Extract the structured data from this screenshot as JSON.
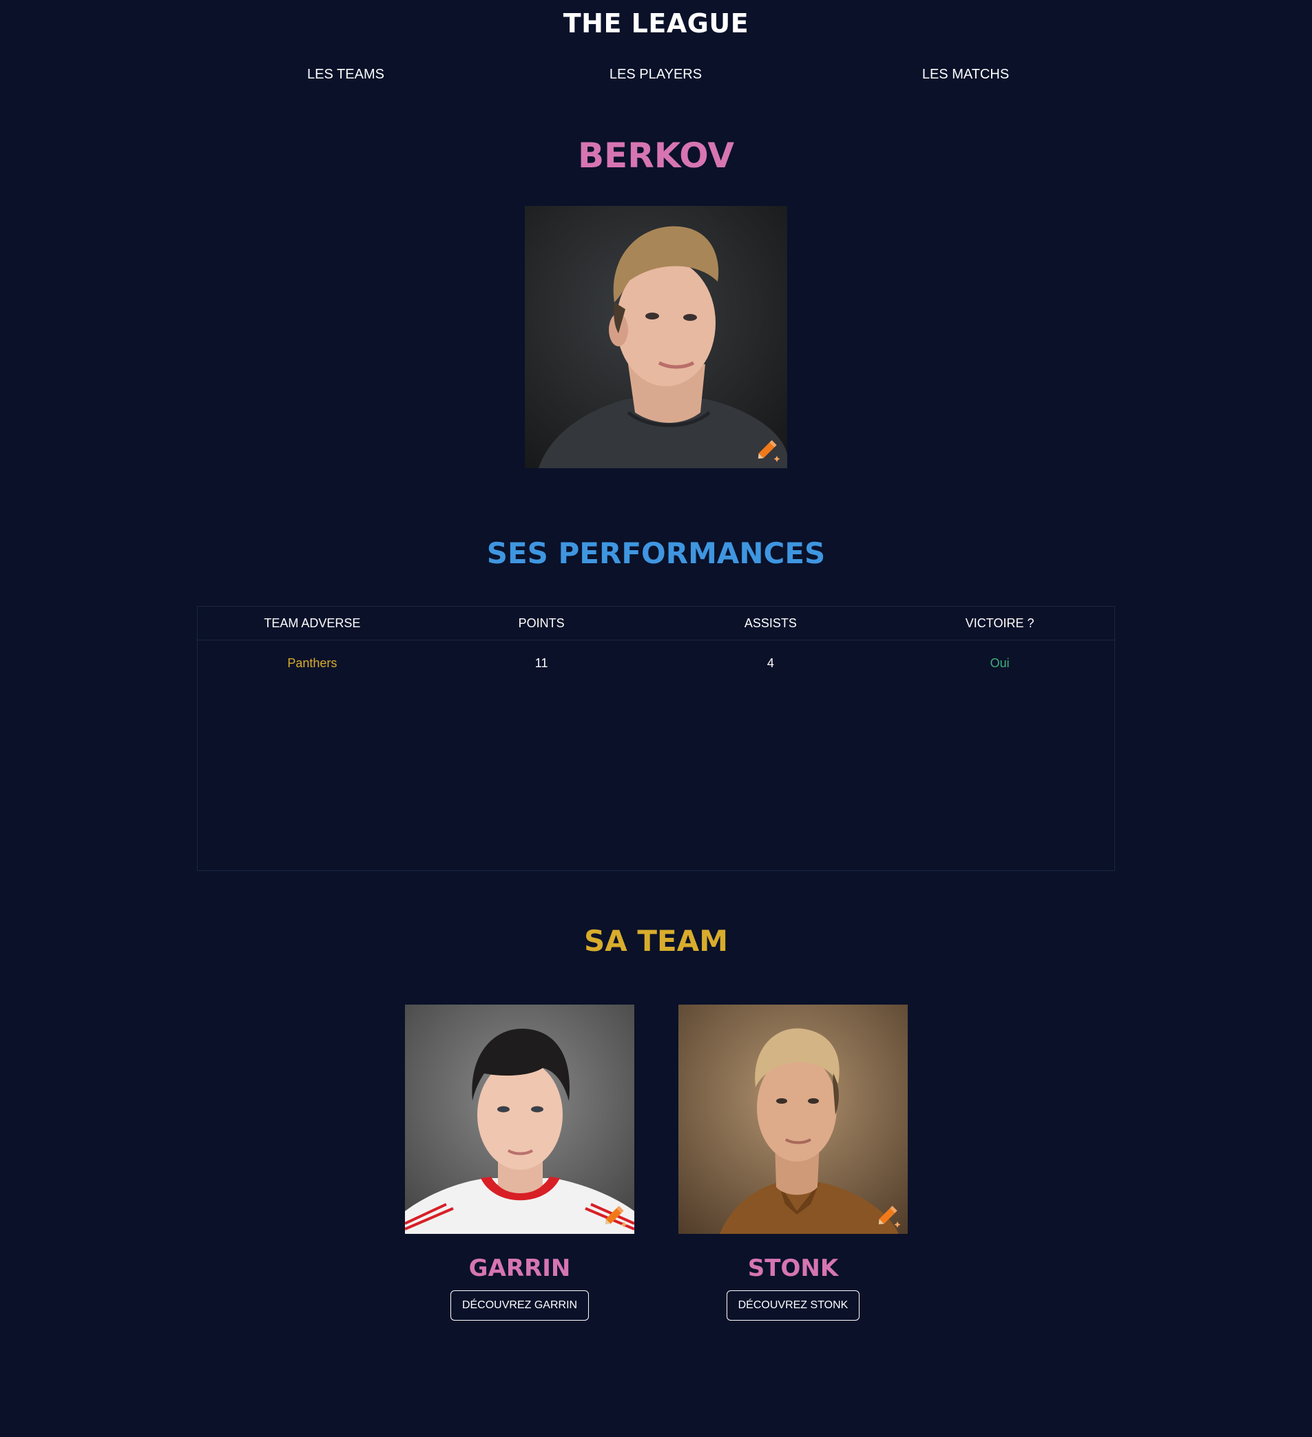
{
  "header": {
    "title": "THE LEAGUE",
    "nav": [
      "LES TEAMS",
      "LES PLAYERS",
      "LES MATCHS"
    ]
  },
  "player": {
    "name": "BERKOV",
    "photo_icon": "pencil-sparkle-icon"
  },
  "performances": {
    "title": "SES PERFORMANCES",
    "columns": [
      "TEAM ADVERSE",
      "POINTS",
      "ASSISTS",
      "VICTOIRE ?"
    ],
    "rows": [
      [
        "Panthers",
        "11",
        "4",
        "Oui"
      ]
    ]
  },
  "team": {
    "title": "SA TEAM",
    "members": [
      {
        "name": "GARRIN",
        "button": "DÉCOUVREZ GARRIN"
      },
      {
        "name": "STONK",
        "button": "DÉCOUVREZ STONK"
      }
    ]
  },
  "colors": {
    "background": "#0a1129",
    "player_name": "#d675b2",
    "performances_title": "#3f96e0",
    "team_title": "#d8ac2c",
    "team_cell": "#d8ac2c",
    "victory_cell": "#3fae7a"
  }
}
